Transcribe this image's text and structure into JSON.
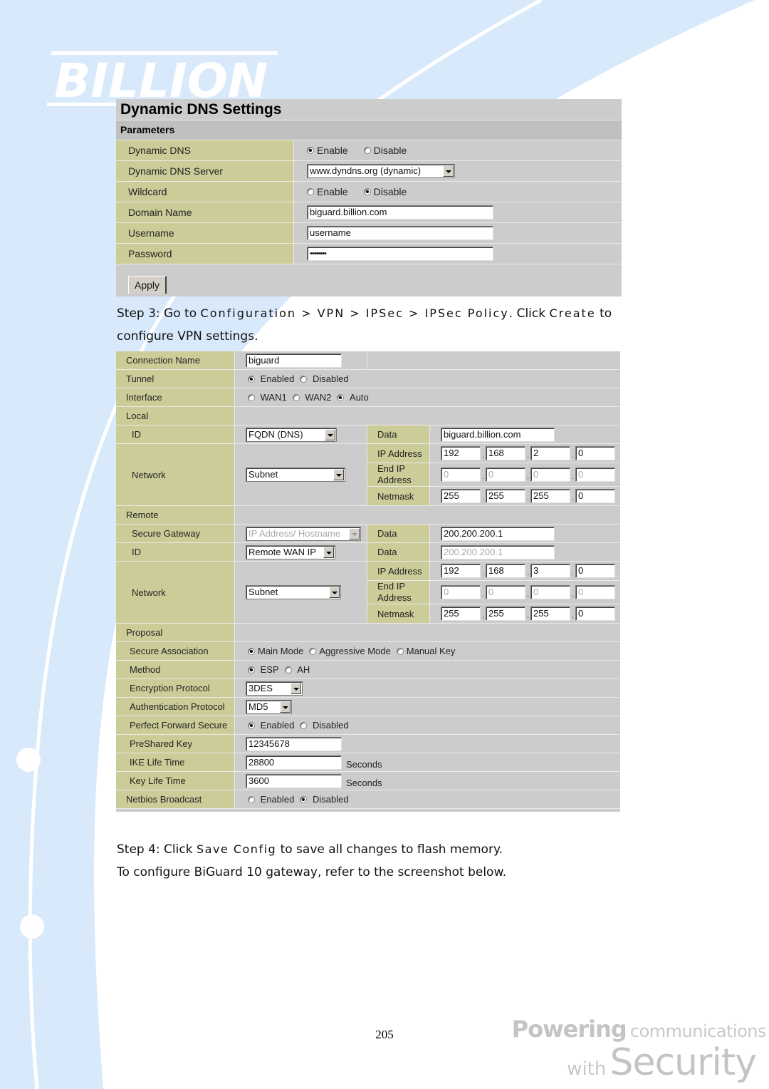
{
  "brand": {
    "logo_text": "BILLION",
    "tagline_line1_bold": "Powering",
    "tagline_line1_rest": "communications",
    "tagline_line2_small": "with",
    "tagline_line2_big": "Security"
  },
  "colors": {
    "label_bg": "#cccc99",
    "panel_bg": "#cccccc",
    "decor_blue": "#d8e9fb"
  },
  "ddns": {
    "title": "Dynamic DNS Settings",
    "section": "Parameters",
    "rows": {
      "dynamic_dns": {
        "label": "Dynamic DNS",
        "options": [
          "Enable",
          "Disable"
        ],
        "selected": "Enable"
      },
      "server": {
        "label": "Dynamic DNS Server",
        "value": "www.dyndns.org (dynamic)"
      },
      "wildcard": {
        "label": "Wildcard",
        "options": [
          "Enable",
          "Disable"
        ],
        "selected": "Disable"
      },
      "domain": {
        "label": "Domain Name",
        "value": "biguard.billion.com"
      },
      "username": {
        "label": "Username",
        "value": "username"
      },
      "password": {
        "label": "Password",
        "value": "••••••••"
      }
    },
    "apply_label": "Apply"
  },
  "step3": {
    "prefix": "Step 3: Go to ",
    "path": "Configuration > VPN > IPSec > IPSec Policy",
    "middle": ". Click ",
    "action": "Create",
    "suffix": " to",
    "line2": "configure VPN settings."
  },
  "vpn": {
    "connection_name": {
      "label": "Connection Name",
      "value": "biguard"
    },
    "tunnel": {
      "label": "Tunnel",
      "options": [
        "Enabled",
        "Disabled"
      ],
      "selected": "Enabled"
    },
    "interface": {
      "label": "Interface",
      "options": [
        "WAN1",
        "WAN2",
        "Auto"
      ],
      "selected": "Auto"
    },
    "local": {
      "label": "Local",
      "id": {
        "label": "ID",
        "type": "FQDN (DNS)",
        "data_label": "Data",
        "data": "biguard.billion.com"
      },
      "network": {
        "label": "Network",
        "type": "Subnet",
        "ip_label": "IP Address",
        "ip": [
          "192",
          "168",
          "2",
          "0"
        ],
        "end_ip_label_1": "End IP",
        "end_ip_label_2": "Address",
        "end_ip": [
          "0",
          "0",
          "0",
          "0"
        ],
        "netmask_label": "Netmask",
        "netmask": [
          "255",
          "255",
          "255",
          "0"
        ]
      }
    },
    "remote": {
      "label": "Remote",
      "secure_gateway": {
        "label": "Secure Gateway",
        "type": "IP Address/ Hostname",
        "data_label": "Data",
        "data": "200.200.200.1"
      },
      "id": {
        "label": "ID",
        "type": "Remote WAN IP",
        "data_label": "Data",
        "data": "200.200.200.1"
      },
      "network": {
        "label": "Network",
        "type": "Subnet",
        "ip_label": "IP Address",
        "ip": [
          "192",
          "168",
          "3",
          "0"
        ],
        "end_ip_label_1": "End IP",
        "end_ip_label_2": "Address",
        "end_ip": [
          "0",
          "0",
          "0",
          "0"
        ],
        "netmask_label": "Netmask",
        "netmask": [
          "255",
          "255",
          "255",
          "0"
        ]
      }
    },
    "proposal": {
      "label": "Proposal"
    },
    "secure_association": {
      "label": "Secure Association",
      "options": [
        "Main Mode",
        "Aggressive Mode",
        "Manual Key"
      ],
      "selected": "Main Mode"
    },
    "method": {
      "label": "Method",
      "options": [
        "ESP",
        "AH"
      ],
      "selected": "ESP"
    },
    "encryption": {
      "label": "Encryption Protocol",
      "value": "3DES"
    },
    "authentication": {
      "label": "Authentication Protocol",
      "value": "MD5"
    },
    "pfs": {
      "label": "Perfect Forward Secure",
      "options": [
        "Enabled",
        "Disabled"
      ],
      "selected": "Enabled"
    },
    "psk": {
      "label": "PreShared Key",
      "value": "12345678"
    },
    "ike_life": {
      "label": "IKE Life Time",
      "value": "28800",
      "unit": "Seconds"
    },
    "key_life": {
      "label": "Key Life Time",
      "value": "3600",
      "unit": "Seconds"
    },
    "netbios": {
      "label": "Netbios Broadcast",
      "options": [
        "Enabled",
        "Disabled"
      ],
      "selected": "Disabled"
    }
  },
  "step4": {
    "prefix": "Step 4: Click ",
    "action": "Save Config",
    "suffix": " to save all changes to flash memory.",
    "line2": "To configure BiGuard 10 gateway, refer to the screenshot below."
  },
  "page_number": "205"
}
